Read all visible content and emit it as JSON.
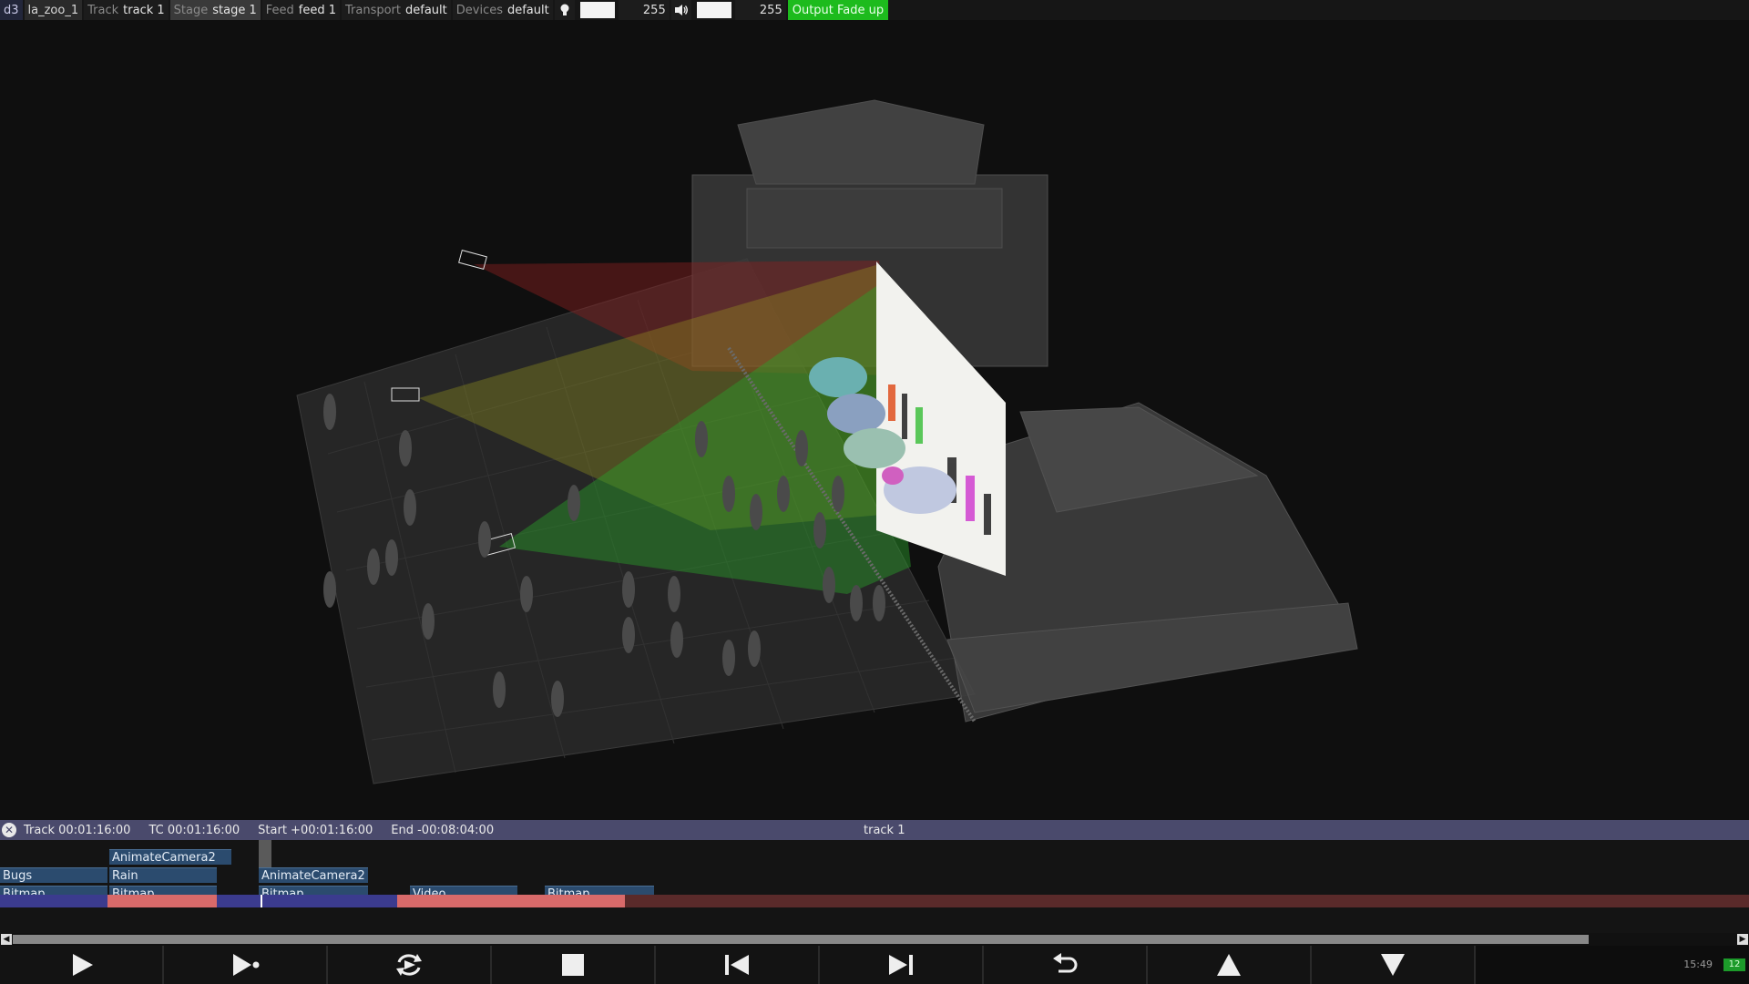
{
  "topbar": {
    "app": "d3",
    "project": "la_zoo_1",
    "track": {
      "key": "Track",
      "value": "track 1"
    },
    "stage": {
      "key": "Stage",
      "value": "stage 1"
    },
    "feed": {
      "key": "Feed",
      "value": "feed 1"
    },
    "transport": {
      "key": "Transport",
      "value": "default"
    },
    "devices": {
      "key": "Devices",
      "value": "default"
    },
    "brightness_value": "255",
    "volume_value": "255",
    "output": "Output Fade up"
  },
  "timeline": {
    "track_time": "Track 00:01:16:00",
    "tc": "TC 00:01:16:00",
    "start": "Start +00:01:16:00",
    "end": "End -00:08:04:00",
    "track_name": "track 1",
    "layers": [
      {
        "label": "AnimateCamera2"
      },
      {
        "label": "Bugs"
      },
      {
        "label": "Rain"
      },
      {
        "label": "AnimateCamera2"
      },
      {
        "label": "Bitmap"
      },
      {
        "label": "Bitmap"
      },
      {
        "label": "Bitmap"
      },
      {
        "label": "Video"
      },
      {
        "label": "Bitmap"
      }
    ]
  },
  "transport_buttons": [
    "play-icon",
    "play-to-end-icon",
    "loop-icon",
    "stop-icon",
    "previous-section-icon",
    "next-section-icon",
    "return-icon",
    "up-icon",
    "down-icon"
  ],
  "status": {
    "clock": "15:49",
    "fps": "12"
  },
  "colors": {
    "output": "#1dbb1d",
    "timeline_header": "#4a4a6c",
    "layer": "#2b4b6e"
  }
}
